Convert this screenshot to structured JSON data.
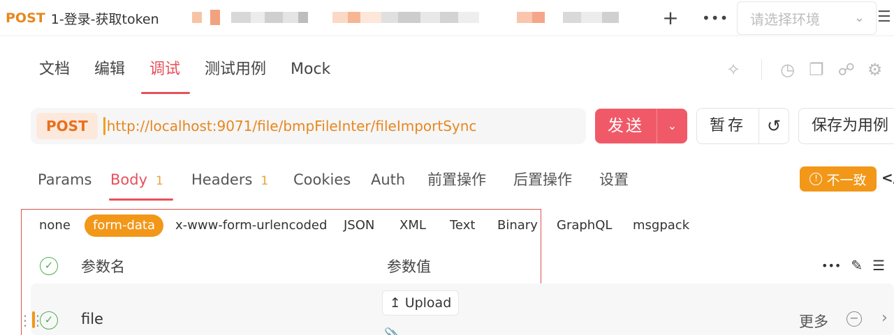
{
  "tabs": {
    "active": {
      "method": "POST",
      "title": "1-登录-获取token"
    },
    "add_icon": "plus-icon",
    "more_icon": "ellipsis-icon"
  },
  "environment": {
    "placeholder": "请选择环境",
    "icon": "chevron-down-icon"
  },
  "doc_tabs": [
    "文档",
    "编辑",
    "调试",
    "测试用例",
    "Mock"
  ],
  "doc_tabs_active": "调试",
  "request": {
    "method": "POST",
    "url": "http://localhost:9071/file/bmpFileInter/fileImportSync",
    "send_label": "发送",
    "save_label": "暂存",
    "save_as_case_label": "保存为用例"
  },
  "request_tabs": [
    {
      "label": "Params",
      "badge": ""
    },
    {
      "label": "Body",
      "badge": "1"
    },
    {
      "label": "Headers",
      "badge": "1"
    },
    {
      "label": "Cookies",
      "badge": ""
    },
    {
      "label": "Auth",
      "badge": ""
    },
    {
      "label": "前置操作",
      "badge": ""
    },
    {
      "label": "后置操作",
      "badge": ""
    },
    {
      "label": "设置",
      "badge": ""
    }
  ],
  "request_tabs_active": "Body",
  "inconsistent_label": "不一致",
  "body_types": [
    "none",
    "form-data",
    "x-www-form-urlencoded",
    "JSON",
    "XML",
    "Text",
    "Binary",
    "GraphQL",
    "msgpack"
  ],
  "body_type_active": "form-data",
  "params_table": {
    "columns": {
      "name": "参数名",
      "value": "参数值"
    },
    "rows": [
      {
        "name": "file",
        "value_button": "Upload",
        "more_label": "更多"
      }
    ]
  },
  "colors": {
    "accent": "#e8505b",
    "orange": "#f29718",
    "send": "#f05a68"
  }
}
